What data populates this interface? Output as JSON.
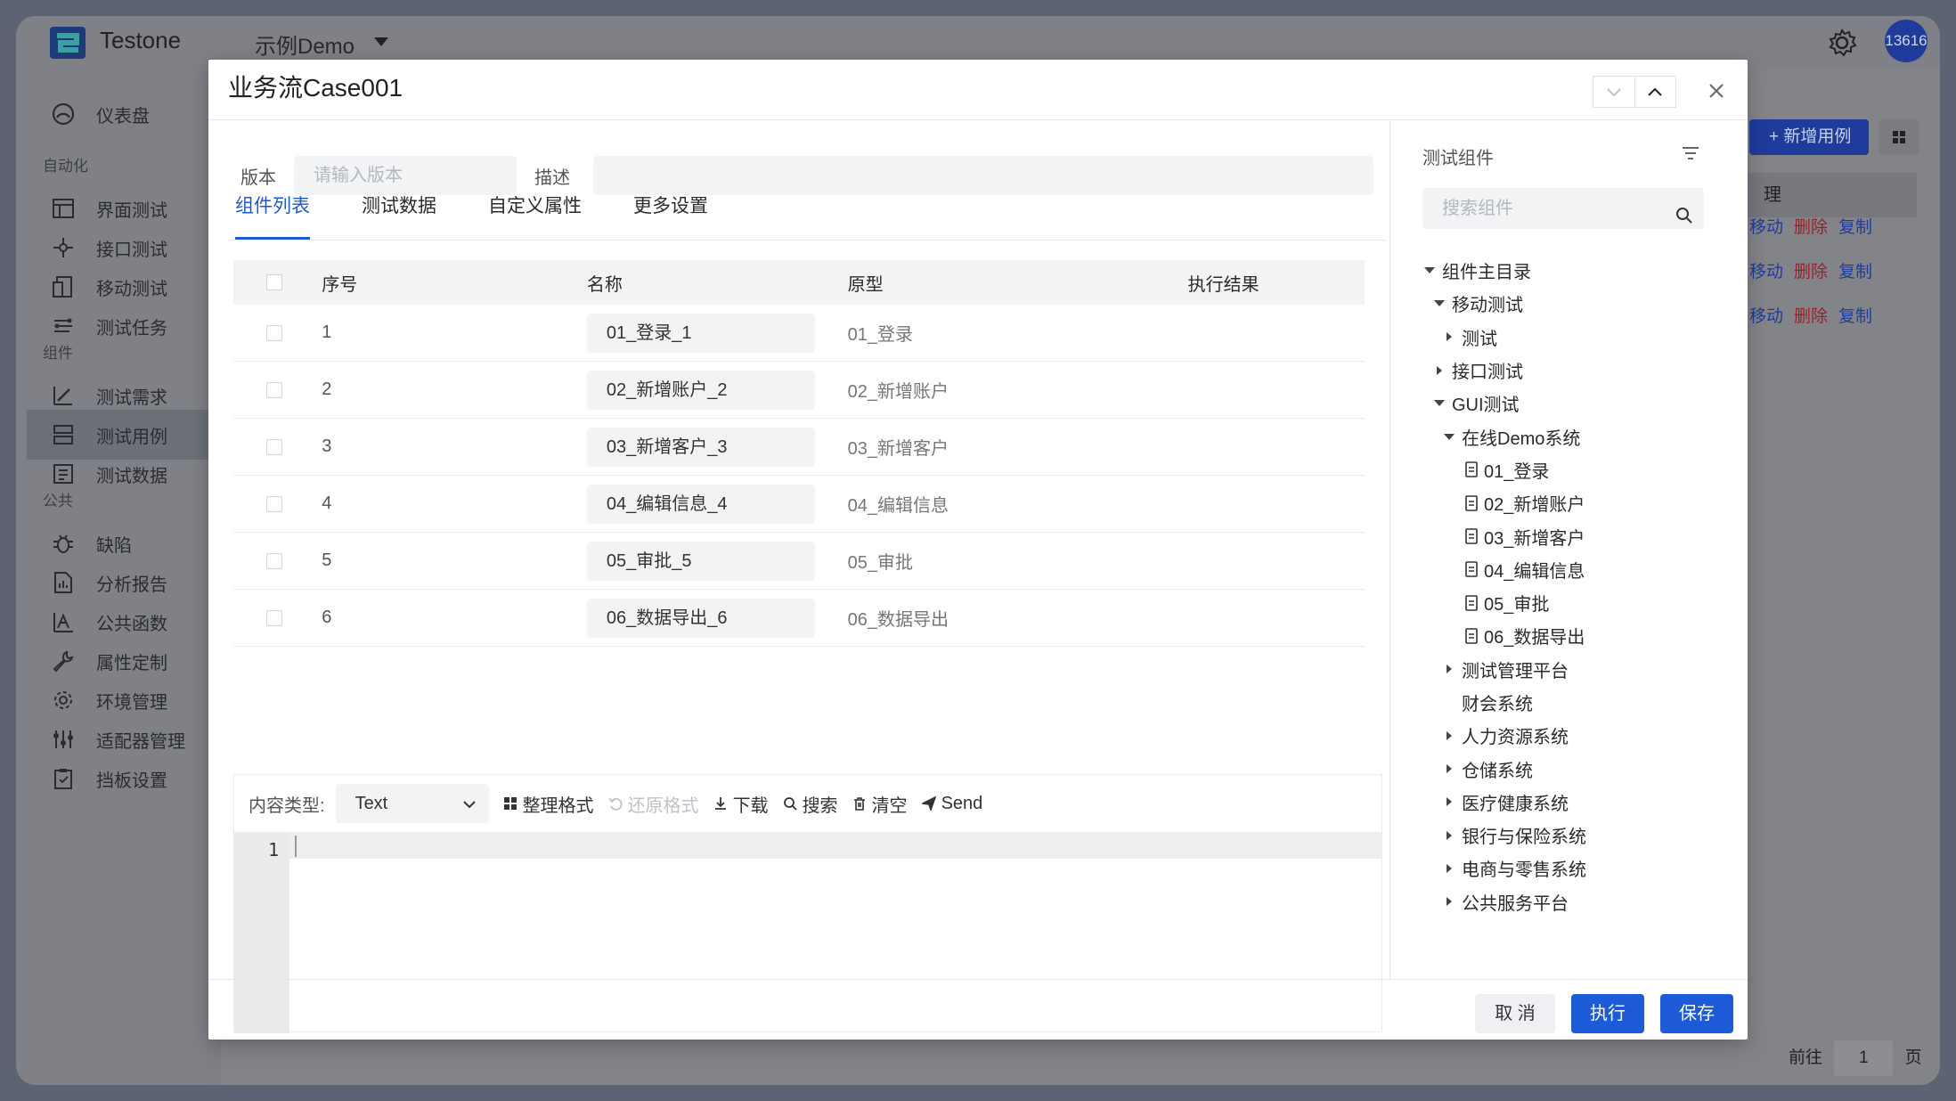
{
  "app": {
    "name": "Testone",
    "project": "示例Demo",
    "user": "13616"
  },
  "sidebar": {
    "items": [
      {
        "label": "仪表盘",
        "icon": "dashboard-icon"
      },
      {
        "group": "自动化"
      },
      {
        "label": "界面测试",
        "icon": "ui-test-icon"
      },
      {
        "label": "接口测试",
        "icon": "api-test-icon"
      },
      {
        "label": "移动测试",
        "icon": "mobile-test-icon"
      },
      {
        "label": "测试任务",
        "icon": "task-icon"
      },
      {
        "group": "组件"
      },
      {
        "label": "测试需求",
        "icon": "requirement-icon"
      },
      {
        "label": "测试用例",
        "icon": "testcase-icon",
        "active": true
      },
      {
        "label": "测试数据",
        "icon": "testdata-icon"
      },
      {
        "group": "公共"
      },
      {
        "label": "缺陷",
        "icon": "bug-icon"
      },
      {
        "label": "分析报告",
        "icon": "report-icon"
      },
      {
        "label": "公共函数",
        "icon": "function-icon"
      },
      {
        "label": "属性定制",
        "icon": "wrench-icon"
      },
      {
        "label": "环境管理",
        "icon": "gear-icon"
      },
      {
        "label": "适配器管理",
        "icon": "adapter-icon"
      },
      {
        "label": "挡板设置",
        "icon": "mock-icon"
      }
    ]
  },
  "background": {
    "new_case_button": "+ 新增用例",
    "table_header_fragment": "理",
    "row_actions": {
      "move": "移动",
      "delete": "删除",
      "copy": "复制"
    },
    "pager": {
      "goto": "前往",
      "page": "1",
      "page_unit": "页"
    }
  },
  "modal": {
    "title": "业务流Case001",
    "version_label": "版本",
    "version_placeholder": "请输入版本",
    "desc_label": "描述",
    "desc_value": "",
    "tabs": [
      "组件列表",
      "测试数据",
      "自定义属性",
      "更多设置"
    ],
    "table": {
      "headers": {
        "index": "序号",
        "name": "名称",
        "proto": "原型",
        "result": "执行结果"
      },
      "rows": [
        {
          "index": "1",
          "name": "01_登录_1",
          "proto": "01_登录",
          "result": ""
        },
        {
          "index": "2",
          "name": "02_新增账户_2",
          "proto": "02_新增账户",
          "result": ""
        },
        {
          "index": "3",
          "name": "03_新增客户_3",
          "proto": "03_新增客户",
          "result": ""
        },
        {
          "index": "4",
          "name": "04_编辑信息_4",
          "proto": "04_编辑信息",
          "result": ""
        },
        {
          "index": "5",
          "name": "05_审批_5",
          "proto": "05_审批",
          "result": ""
        },
        {
          "index": "6",
          "name": "06_数据导出_6",
          "proto": "06_数据导出",
          "result": ""
        }
      ]
    },
    "editor": {
      "content_type_label": "内容类型:",
      "content_type": "Text",
      "format": "整理格式",
      "restore": "还原格式",
      "download": "下载",
      "search": "搜索",
      "clear": "清空",
      "send": "Send",
      "line_number": "1"
    },
    "side": {
      "title": "测试组件",
      "search_placeholder": "搜索组件",
      "tree": [
        {
          "label": "组件主目录",
          "level": 0,
          "type": "open"
        },
        {
          "label": "移动测试",
          "level": 1,
          "type": "open"
        },
        {
          "label": "测试",
          "level": 2,
          "type": "closed"
        },
        {
          "label": "接口测试",
          "level": 1,
          "type": "closed"
        },
        {
          "label": "GUI测试",
          "level": 1,
          "type": "open"
        },
        {
          "label": "在线Demo系统",
          "level": 2,
          "type": "open"
        },
        {
          "label": "01_登录",
          "level": 3,
          "type": "doc"
        },
        {
          "label": "02_新增账户",
          "level": 3,
          "type": "doc"
        },
        {
          "label": "03_新增客户",
          "level": 3,
          "type": "doc"
        },
        {
          "label": "04_编辑信息",
          "level": 3,
          "type": "doc"
        },
        {
          "label": "05_审批",
          "level": 3,
          "type": "doc"
        },
        {
          "label": "06_数据导出",
          "level": 3,
          "type": "doc"
        },
        {
          "label": "测试管理平台",
          "level": 2,
          "type": "closed"
        },
        {
          "label": "财会系统",
          "level": 2,
          "type": "leaf"
        },
        {
          "label": "人力资源系统",
          "level": 2,
          "type": "closed"
        },
        {
          "label": "仓储系统",
          "level": 2,
          "type": "closed"
        },
        {
          "label": "医疗健康系统",
          "level": 2,
          "type": "closed"
        },
        {
          "label": "银行与保险系统",
          "level": 2,
          "type": "closed"
        },
        {
          "label": "电商与零售系统",
          "level": 2,
          "type": "closed"
        },
        {
          "label": "公共服务平台",
          "level": 2,
          "type": "closed"
        }
      ]
    },
    "footer": {
      "cancel": "取 消",
      "run": "执行",
      "save": "保存"
    }
  },
  "colors": {
    "accent": "#1d5ad8",
    "overlay": "#7d7f85",
    "danger": "#9c1f2a"
  }
}
